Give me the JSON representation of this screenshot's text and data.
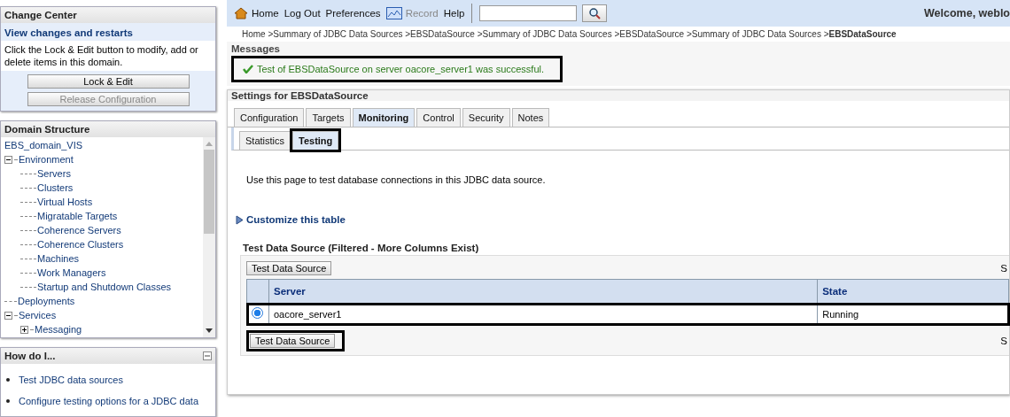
{
  "change_center": {
    "title": "Change Center",
    "subtitle": "View changes and restarts",
    "text": "Click the Lock & Edit button to modify, add or delete items in this domain.",
    "buttons": [
      {
        "label": "Lock & Edit",
        "disabled": false
      },
      {
        "label": "Release Configuration",
        "disabled": true
      }
    ]
  },
  "domain_structure": {
    "title": "Domain Structure",
    "root": "EBS_domain_VIS",
    "tree": [
      {
        "label": "Environment",
        "expanded": true,
        "children": [
          {
            "label": "Servers"
          },
          {
            "label": "Clusters"
          },
          {
            "label": "Virtual Hosts"
          },
          {
            "label": "Migratable Targets"
          },
          {
            "label": "Coherence Servers"
          },
          {
            "label": "Coherence Clusters"
          },
          {
            "label": "Machines"
          },
          {
            "label": "Work Managers"
          },
          {
            "label": "Startup and Shutdown Classes"
          }
        ]
      },
      {
        "label": "Deployments"
      },
      {
        "label": "Services",
        "expanded": true,
        "children": [
          {
            "label": "Messaging",
            "expanded": false
          }
        ]
      }
    ]
  },
  "how_do_i": {
    "title": "How do I...",
    "links": [
      "Test JDBC data sources",
      "Configure testing options for a JDBC data"
    ]
  },
  "toolbar": {
    "links": [
      {
        "label": "Home",
        "kind": "home",
        "disabled": false
      },
      {
        "label": "Log Out",
        "kind": "plain",
        "disabled": false
      },
      {
        "label": "Preferences",
        "kind": "plain",
        "disabled": false
      },
      {
        "label": "Record",
        "kind": "record",
        "disabled": true
      },
      {
        "label": "Help",
        "kind": "plain",
        "disabled": false
      }
    ],
    "welcome": "Welcome, weblo"
  },
  "breadcrumb": [
    "Home >",
    "Summary of JDBC Data Sources >",
    "EBSDataSource >",
    "Summary of JDBC Data Sources >",
    "EBSDataSource >",
    "Summary of JDBC Data Sources >",
    "EBSDataSource"
  ],
  "messages": {
    "title": "Messages",
    "text": "Test of EBSDataSource on server oacore_server1 was successful.",
    "highlighted": true
  },
  "settings_title": "Settings for EBSDataSource",
  "tabs": [
    {
      "label": "Configuration",
      "selected": false
    },
    {
      "label": "Targets",
      "selected": false
    },
    {
      "label": "Monitoring",
      "selected": true
    },
    {
      "label": "Control",
      "selected": false
    },
    {
      "label": "Security",
      "selected": false
    },
    {
      "label": "Notes",
      "selected": false
    }
  ],
  "subtabs": [
    {
      "label": "Statistics",
      "selected": false,
      "highlighted": false
    },
    {
      "label": "Testing",
      "selected": true,
      "highlighted": true
    }
  ],
  "intro": "Use this page to test database connections in this JDBC data source.",
  "customize": "Customize this table",
  "table": {
    "title": "Test Data Source (Filtered - More Columns Exist)",
    "top_button": {
      "label": "Test Data Source"
    },
    "bottom_button": {
      "label": "Test Data Source",
      "highlighted": true
    },
    "pager_top": "S",
    "pager_bottom": "S",
    "columns": [
      "Server",
      "State"
    ],
    "rows": [
      {
        "selected": true,
        "highlighted": true,
        "cells": [
          "oacore_server1",
          "Running"
        ]
      }
    ]
  }
}
